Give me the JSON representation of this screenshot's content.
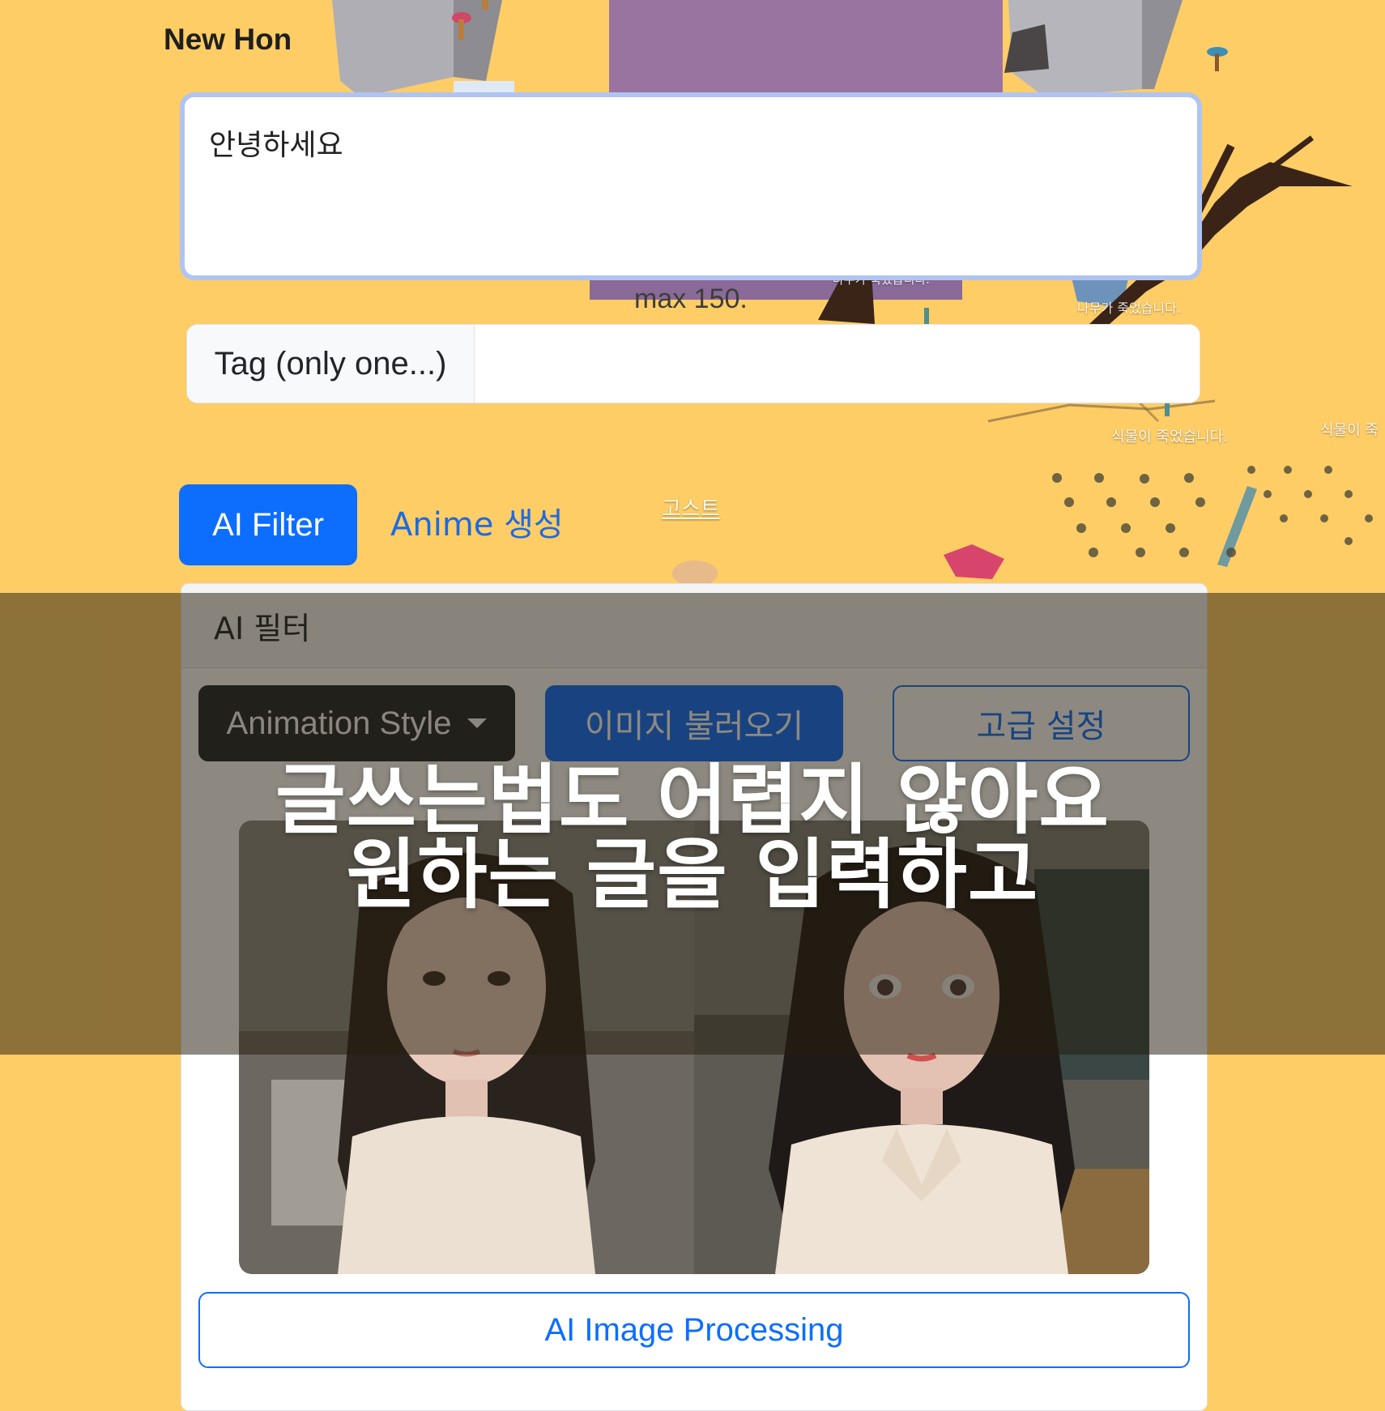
{
  "page": {
    "title": "New Hon"
  },
  "post": {
    "content": "안녕하세요",
    "limit_text": "max 150."
  },
  "tag": {
    "label": "Tag (only one...)",
    "value": ""
  },
  "tabs": [
    {
      "label": "AI Filter",
      "active": true
    },
    {
      "label": "Anime 생성",
      "active": false
    }
  ],
  "card": {
    "header": "AI 필터",
    "style_dropdown_label": "Animation Style",
    "load_image_label": "이미지 불러오기",
    "advanced_label": "고급 설정",
    "process_label": "AI Image Processing"
  },
  "overlay": {
    "line1": "글쓰는법도 어렵지 않아요",
    "line2": "원하는 글을 입력하고"
  },
  "background_labels": {
    "tree_dead_1": "나무가 죽었습니다.",
    "tree_dead_2": "나무가 죽었습니다.",
    "plant_dead_1": "식물이 죽었습니다.",
    "plant_dead_2": "식물이 죽",
    "ghost": "고스트"
  },
  "colors": {
    "background": "#fecd66",
    "primary": "#0d6efd",
    "dark": "#212529"
  }
}
